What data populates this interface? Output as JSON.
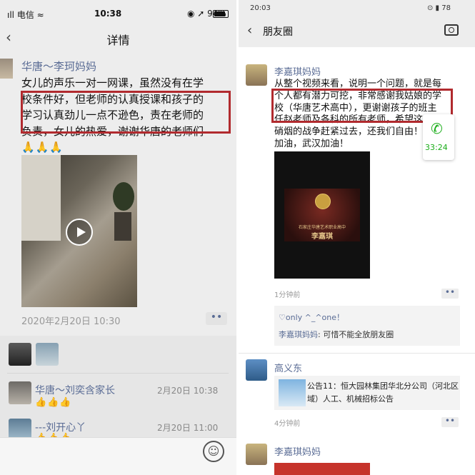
{
  "left": {
    "status": {
      "carrier": "ıll 电信 ≈",
      "time": "10:38",
      "battery_text": "◉ ➚ 94%"
    },
    "nav": {
      "back": "‹",
      "title": "详情"
    },
    "post": {
      "author": "华唐～李珂妈妈",
      "lines": [
        "女儿的声乐一对一网课，虽然没有在学",
        "校条件好，但老师的认真授课和孩子的",
        "学习认真劲儿一点不逊色，责在老师的",
        "负责，女儿的热爱，谢谢华唐的老师们"
      ],
      "emoji_line": "🙏🙏🙏",
      "timestamp": "2020年2月20日 10:30",
      "more": "••"
    },
    "comments": [
      {
        "name": "华唐～刘奕含家长",
        "time": "2月20日 10:38",
        "emoji": "👍👍👍"
      },
      {
        "name": "---刘开心丫",
        "time": "2月20日 11:00",
        "emoji": "👍👍👍"
      }
    ],
    "input": {
      "emoji_button": "☺"
    },
    "colors": {
      "highlight": "#b12a2e",
      "link": "#5a6c95"
    }
  },
  "right": {
    "status": {
      "time": "20:03",
      "right": "⊙ ▮ 78"
    },
    "nav": {
      "back": "‹",
      "title": "朋友圈"
    },
    "post": {
      "author": "李嘉琪妈妈",
      "lines": [
        "从整个视频来看，说明一个问题，就是每",
        "个人都有潜力可挖，非常感谢我姑娘的学",
        "校（华唐艺术高中），更谢谢孩子的班主",
        "任赵老师及各科的所有老师，希望这",
        "硝烟的战争赶紧过去，还我们自由！",
        "加油，武汉加油！"
      ],
      "video_school": "石家庄华唐艺术职业高中",
      "video_name": "李嘉琪",
      "time_ago": "1分钟前",
      "more": "••",
      "like": "♡only ^_^one！",
      "comment_name": "李嘉琪妈妈",
      "comment_text": ": 可惜不能全放朋友圈"
    },
    "call": {
      "icon": "✆",
      "duration": "33:24"
    },
    "post2": {
      "author": "高义东",
      "share_text": "公告11：恒大园林集团华北分公司（河北区域）人工、机械招标公告",
      "time_ago": "4分钟前",
      "more": "••"
    },
    "post3": {
      "author": "李嘉琪妈妈"
    }
  }
}
